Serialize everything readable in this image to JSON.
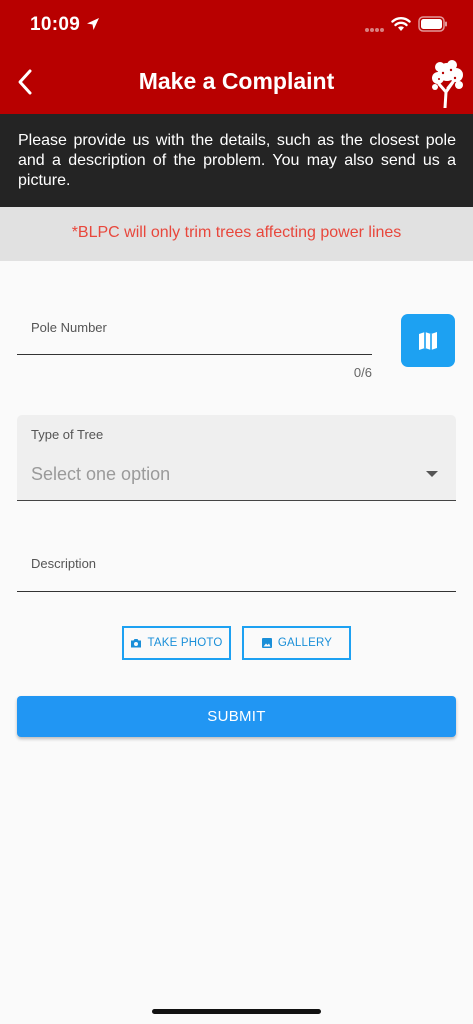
{
  "status_bar": {
    "time": "10:09"
  },
  "header": {
    "title": "Make a Complaint"
  },
  "info": {
    "text": "Please provide us with the details, such as the closest pole and a description of the problem. You may also send us a picture."
  },
  "notice": {
    "text": "*BLPC will only trim trees affecting power lines"
  },
  "form": {
    "pole_number": {
      "label": "Pole Number",
      "value": "",
      "counter": "0/6"
    },
    "tree_type": {
      "label": "Type of Tree",
      "value": "Select one option"
    },
    "description": {
      "label": "Description",
      "value": ""
    }
  },
  "buttons": {
    "take_photo": "TAKE PHOTO",
    "gallery": "GALLERY",
    "submit": "SUBMIT"
  },
  "colors": {
    "header_red": "#b80000",
    "info_dark": "#242424",
    "notice_red": "#e8473c",
    "accent_blue": "#1da1f2",
    "submit_blue": "#2196f3"
  },
  "icons": [
    "location-arrow-icon",
    "cellular-signal-icon",
    "wifi-icon",
    "battery-icon",
    "back-chevron-icon",
    "tree-logo-icon",
    "map-icon",
    "dropdown-caret-icon",
    "camera-icon",
    "gallery-image-icon"
  ]
}
